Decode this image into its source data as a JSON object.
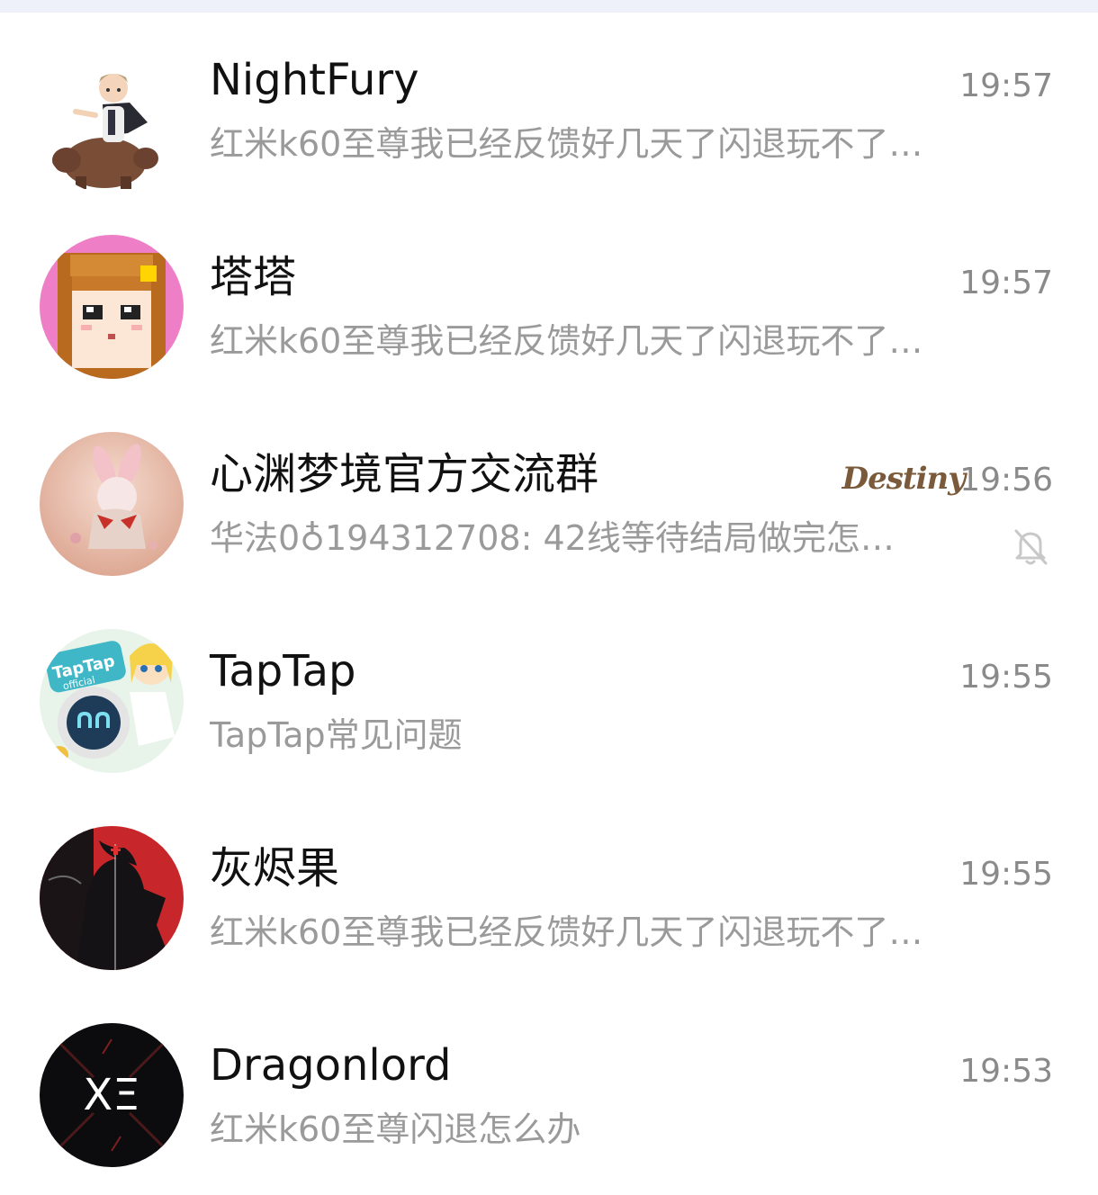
{
  "chats": [
    {
      "name": "NightFury",
      "time": "19:57",
      "preview": "红米k60至尊我已经反馈好几天了闪退玩不了…",
      "avatar_icon": "cartoon-rider-avatar"
    },
    {
      "name": "塔塔",
      "time": "19:57",
      "preview": "红米k60至尊我已经反馈好几天了闪退玩不了…",
      "avatar_icon": "pixel-girl-avatar"
    },
    {
      "name": "心渊梦境官方交流群",
      "time": "19:56",
      "preview": "华法0♁194312708: 42线等待结局做完怎…",
      "badge": "Destiny",
      "muted": true,
      "avatar_icon": "anime-girl-avatar"
    },
    {
      "name": "TapTap",
      "time": "19:55",
      "preview": "TapTap常见问题",
      "avatar_icon": "taptap-official-avatar",
      "avatar_text": "TapTap official"
    },
    {
      "name": "灰烬果",
      "time": "19:55",
      "preview": "红米k60至尊我已经反馈好几天了闪退玩不了…",
      "avatar_icon": "dark-silhouette-avatar"
    },
    {
      "name": "Dragonlord",
      "time": "19:53",
      "preview": "红米k60至尊闪退怎么办",
      "avatar_icon": "xe-logo-avatar",
      "avatar_text": "XΞ"
    }
  ],
  "colors": {
    "name": "#111111",
    "time": "#8a8a8a",
    "preview": "#9a9a9a",
    "top_strip": "#eef1fa"
  }
}
